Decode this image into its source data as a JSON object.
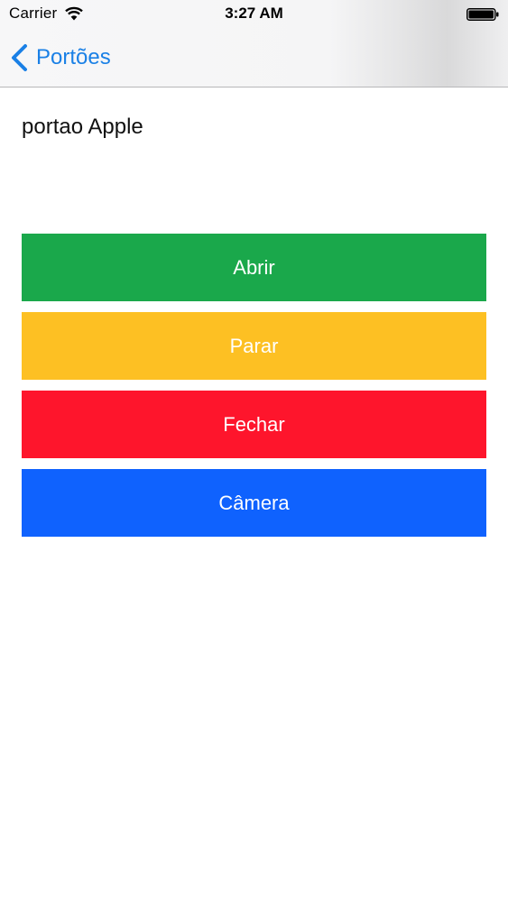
{
  "status_bar": {
    "carrier": "Carrier",
    "time": "3:27 AM",
    "wifi_icon": "wifi-icon",
    "battery_icon": "battery-icon"
  },
  "nav": {
    "back_label": "Portões",
    "back_icon": "chevron-left-icon",
    "accent_color": "#1a80e6"
  },
  "gate": {
    "name": "portao Apple"
  },
  "actions": [
    {
      "label": "Abrir",
      "color": "#1aa84b"
    },
    {
      "label": "Parar",
      "color": "#fdc023"
    },
    {
      "label": "Fechar",
      "color": "#fe152c"
    },
    {
      "label": "Câmera",
      "color": "#0f62fe"
    }
  ]
}
